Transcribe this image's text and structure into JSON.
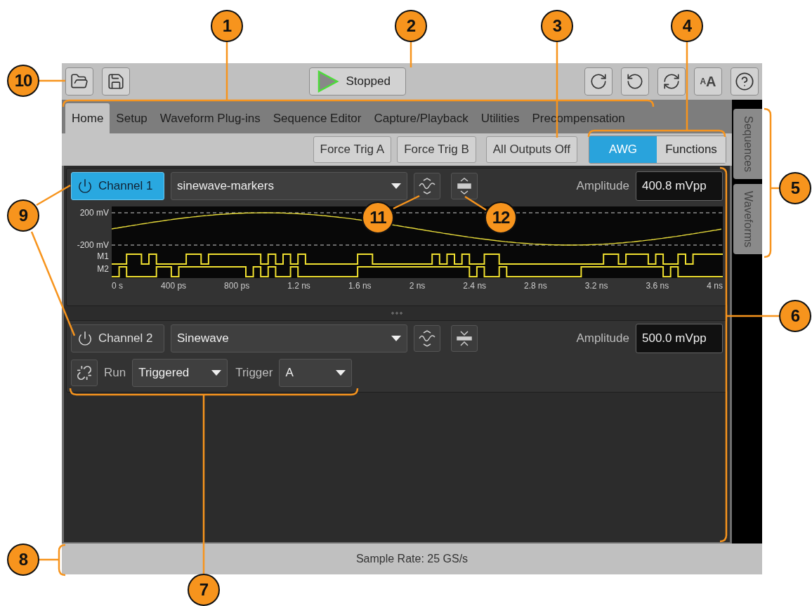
{
  "callouts": [
    {
      "label": "1"
    },
    {
      "label": "2"
    },
    {
      "label": "3"
    },
    {
      "label": "4"
    },
    {
      "label": "10"
    },
    {
      "label": "5"
    },
    {
      "label": "9"
    },
    {
      "label": "11"
    },
    {
      "label": "12"
    },
    {
      "label": "6"
    },
    {
      "label": "8"
    },
    {
      "label": "7"
    }
  ],
  "toolbar": {
    "status_button": "Stopped",
    "text_size": {
      "small": "A",
      "large": "A"
    }
  },
  "tabs": [
    {
      "label": "Home",
      "selected": true
    },
    {
      "label": "Setup",
      "selected": false
    },
    {
      "label": "Waveform Plug-ins",
      "selected": false
    },
    {
      "label": "Sequence Editor",
      "selected": false
    },
    {
      "label": "Capture/Playback",
      "selected": false
    },
    {
      "label": "Utilities",
      "selected": false
    },
    {
      "label": "Precompensation",
      "selected": false
    }
  ],
  "action_buttons": [
    {
      "label": "Force Trig A"
    },
    {
      "label": "Force Trig B"
    },
    {
      "label": "All Outputs Off"
    }
  ],
  "mode_toggle": [
    {
      "label": "AWG",
      "selected": true
    },
    {
      "label": "Functions",
      "selected": false
    }
  ],
  "side_tabs": [
    {
      "label": "Sequences"
    },
    {
      "label": "Waveforms"
    }
  ],
  "channels": [
    {
      "name": "Channel 1",
      "on": true,
      "expanded": true,
      "waveform": "sinewave-markers",
      "amplitude_label": "Amplitude",
      "amplitude": "400.8 mVpp",
      "plot": {
        "y_labels": [
          "200 mV",
          "-200 mV"
        ],
        "marker_labels": [
          "M1",
          "M2"
        ],
        "x_labels": [
          "0 s",
          "400 ps",
          "800 ps",
          "1.2 ns",
          "1.6 ns",
          "2 ns",
          "2.4 ns",
          "2.8 ns",
          "3.2 ns",
          "3.6 ns",
          "4 ns"
        ]
      }
    },
    {
      "name": "Channel 2",
      "on": false,
      "expanded": false,
      "waveform": "Sinewave",
      "amplitude_label": "Amplitude",
      "amplitude": "500.0 mVpp",
      "run_label": "Run",
      "run_mode": "Triggered",
      "trigger_label": "Trigger",
      "trigger": "A"
    }
  ],
  "status_bar": "Sample Rate: 25 GS/s"
}
